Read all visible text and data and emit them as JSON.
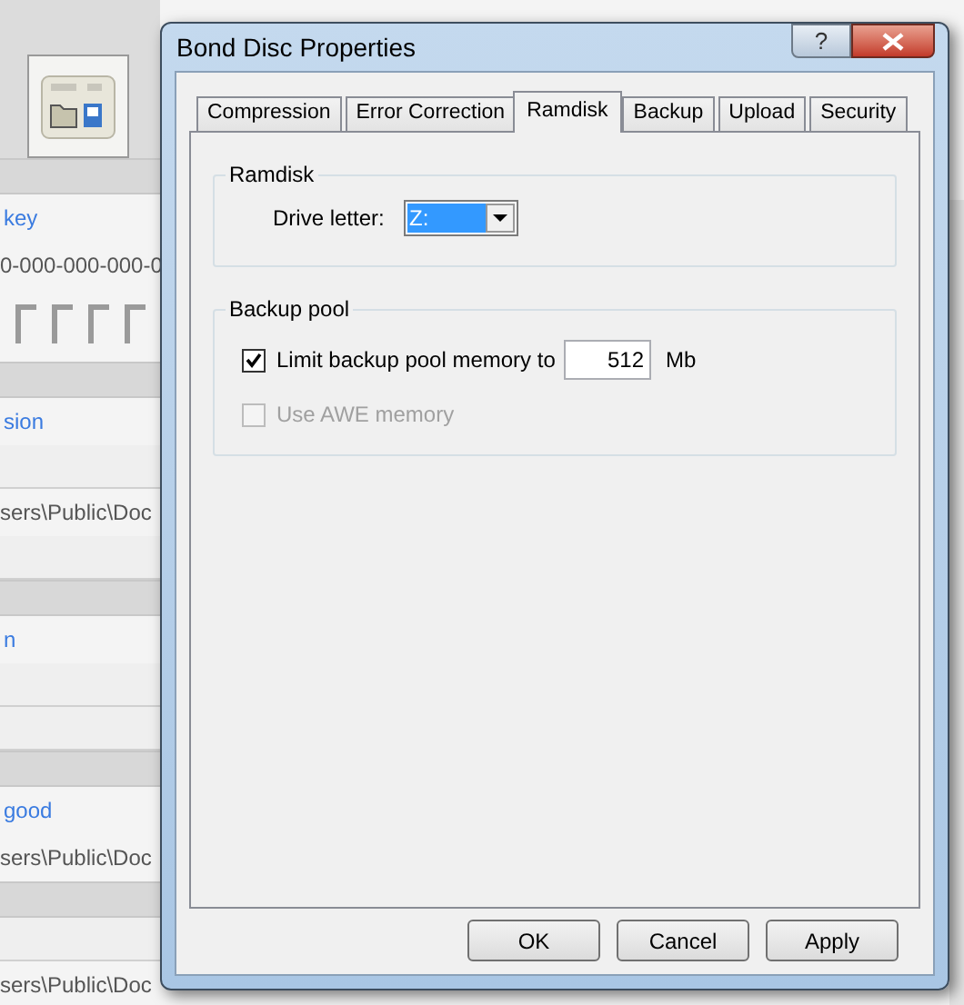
{
  "background": {
    "rows": [
      {
        "kind": "band"
      },
      {
        "kind": "link",
        "text": "key"
      },
      {
        "kind": "text",
        "text": "0-000-000-000-0"
      },
      {
        "kind": "glyphs"
      },
      {
        "kind": "band"
      },
      {
        "kind": "link",
        "text": "sion"
      },
      {
        "kind": "blank"
      },
      {
        "kind": "text",
        "text": "sers\\Public\\Doc"
      },
      {
        "kind": "blank"
      },
      {
        "kind": "band"
      },
      {
        "kind": "link",
        "text": "n"
      },
      {
        "kind": "blank"
      },
      {
        "kind": "blank"
      },
      {
        "kind": "band"
      },
      {
        "kind": "link",
        "text": "good"
      },
      {
        "kind": "text",
        "text": "sers\\Public\\Doc"
      },
      {
        "kind": "band"
      },
      {
        "kind": "blank"
      },
      {
        "kind": "text",
        "text": "sers\\Public\\Doc"
      }
    ]
  },
  "dialog": {
    "title": "Bond Disc Properties",
    "help": "?",
    "tabs": [
      {
        "label": "Compression",
        "selected": false
      },
      {
        "label": "Error Correction",
        "selected": false
      },
      {
        "label": "Ramdisk",
        "selected": true
      },
      {
        "label": "Backup",
        "selected": false
      },
      {
        "label": "Upload",
        "selected": false
      },
      {
        "label": "Security",
        "selected": false
      }
    ],
    "ramdisk": {
      "title": "Ramdisk",
      "label": "Drive letter:",
      "value": "Z:"
    },
    "backup_pool": {
      "title": "Backup pool",
      "limit": {
        "label": "Limit backup pool memory to",
        "checked": true,
        "value": "512",
        "unit": "Mb"
      },
      "awe": {
        "label": "Use AWE memory",
        "checked": false,
        "disabled": true
      }
    },
    "buttons": [
      "OK",
      "Cancel",
      "Apply"
    ]
  }
}
